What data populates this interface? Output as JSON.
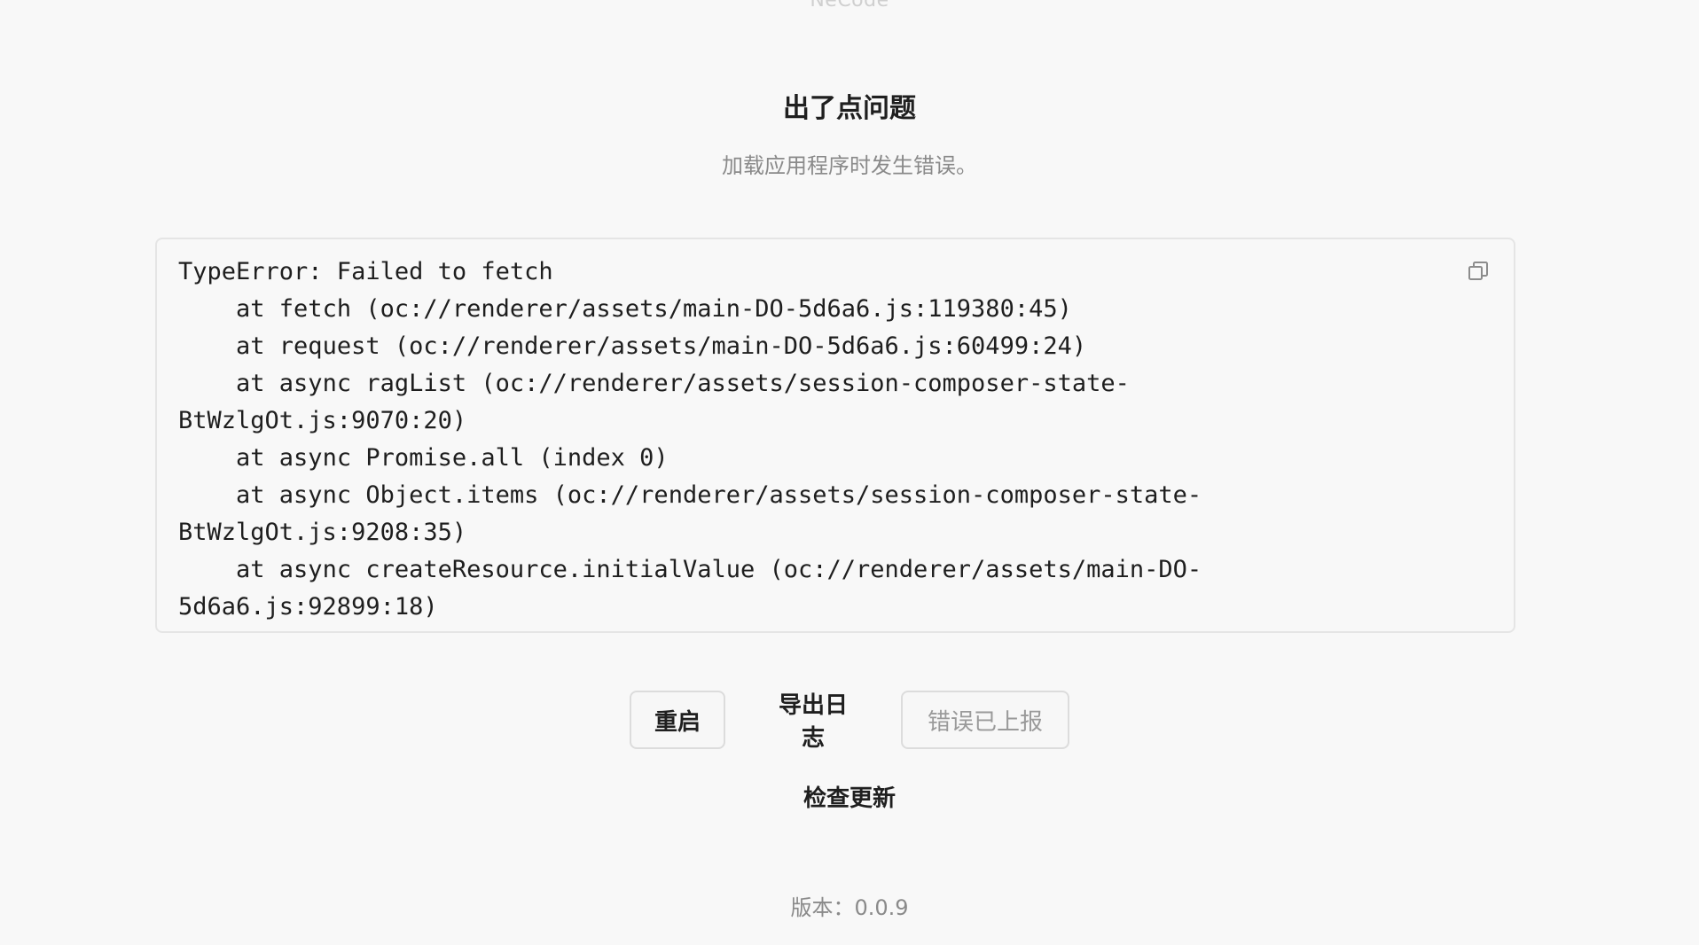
{
  "header": {
    "brand": "NeCode",
    "title": "出了点问题",
    "subtitle": "加载应用程序时发生错误。"
  },
  "error": {
    "text": "TypeError: Failed to fetch\n    at fetch (oc://renderer/assets/main-DO-5d6a6.js:119380:45)\n    at request (oc://renderer/assets/main-DO-5d6a6.js:60499:24)\n    at async ragList (oc://renderer/assets/session-composer-state-\nBtWzlgOt.js:9070:20)\n    at async Promise.all (index 0)\n    at async Object.items (oc://renderer/assets/session-composer-state-\nBtWzlgOt.js:9208:35)\n    at async createResource.initialValue (oc://renderer/assets/main-DO-\n5d6a6.js:92899:18)",
    "copy_icon": "copy-icon"
  },
  "actions": {
    "restart_label": "重启",
    "export_logs_label": "导出日志",
    "reported_label": "错误已上报",
    "check_update_label": "检查更新"
  },
  "footer": {
    "version": "版本：0.0.9"
  },
  "colors": {
    "background": "#f8f8f8",
    "text": "#1f1f1f",
    "muted": "#8a8a8a",
    "border": "#e5e5e5"
  }
}
